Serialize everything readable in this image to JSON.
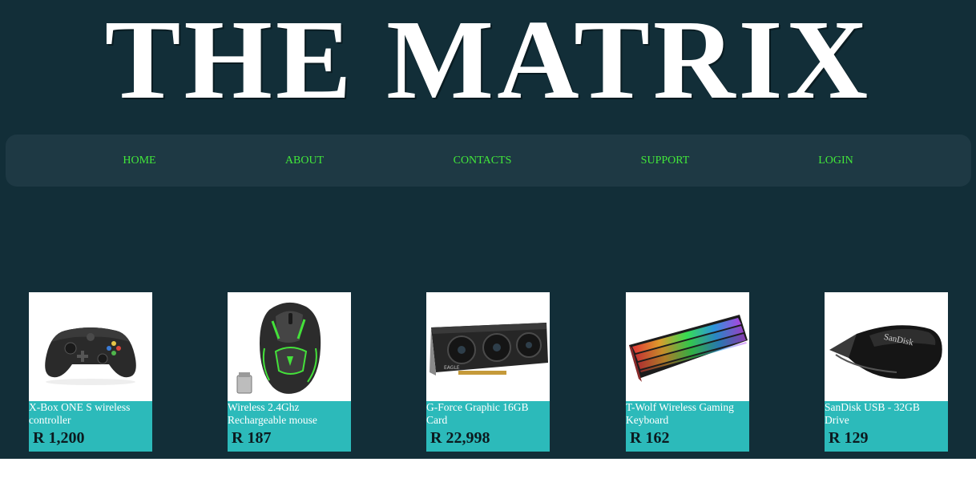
{
  "site": {
    "title": "THE MATRIX"
  },
  "nav": {
    "items": [
      {
        "label": "HOME"
      },
      {
        "label": "ABOUT"
      },
      {
        "label": "CONTACTS"
      },
      {
        "label": "SUPPORT"
      },
      {
        "label": "LOGIN"
      }
    ]
  },
  "products": [
    {
      "name": "X-Box ONE S wireless controller",
      "price": "R 1,200",
      "image_icon": "game-controller-icon"
    },
    {
      "name": "Wireless 2.4Ghz Rechargeable mouse",
      "price": "R 187",
      "image_icon": "gaming-mouse-icon"
    },
    {
      "name": "G-Force Graphic 16GB Card",
      "price": "R 22,998",
      "image_icon": "graphics-card-icon"
    },
    {
      "name": "T-Wolf Wireless Gaming Keyboard",
      "price": "R 162",
      "image_icon": "keyboard-icon"
    },
    {
      "name": "SanDisk USB - 32GB Drive",
      "price": "R 129",
      "image_icon": "usb-drive-icon",
      "image_text": "SanDisk"
    }
  ],
  "colors": {
    "page_background": "#122e38",
    "nav_background": "#1e3944",
    "nav_link": "#42e83a",
    "card_background": "#2cbaba",
    "price_text": "#0c1a1f",
    "title_text": "#ffffff"
  }
}
